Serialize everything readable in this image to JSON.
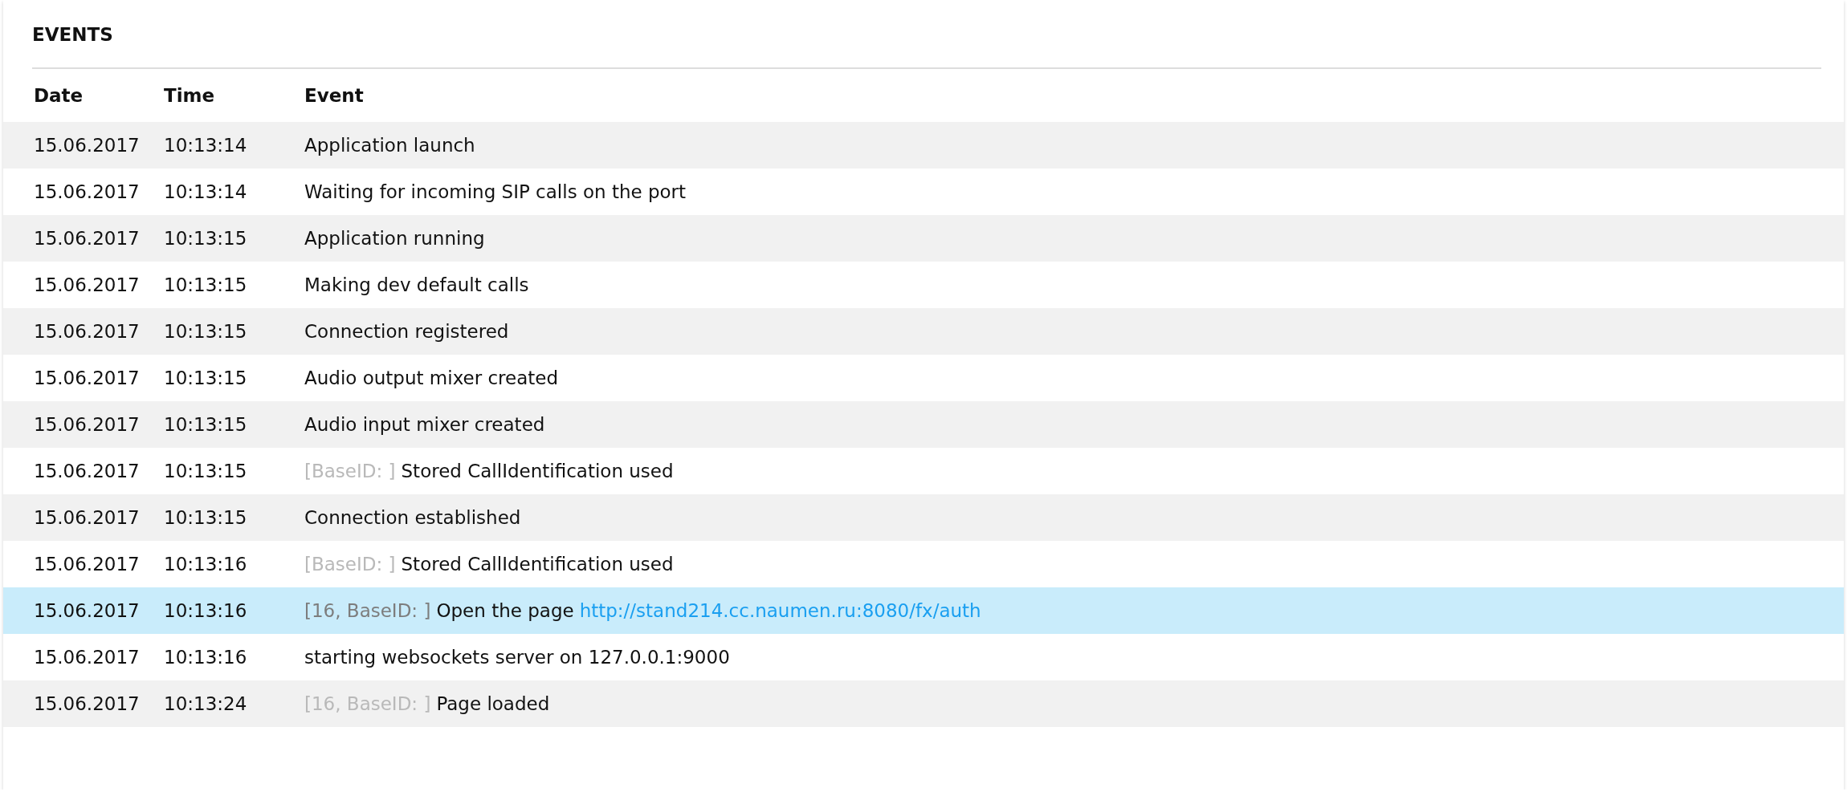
{
  "panel": {
    "title": "EVENTS"
  },
  "table": {
    "columns": [
      "Date",
      "Time",
      "Event"
    ],
    "rows": [
      {
        "date": "15.06.2017",
        "time": "10:13:14",
        "message": "Application launch",
        "selected": false
      },
      {
        "date": "15.06.2017",
        "time": "10:13:14",
        "message": "Waiting for incoming SIP calls on the port",
        "selected": false
      },
      {
        "date": "15.06.2017",
        "time": "10:13:15",
        "message": "Application running",
        "selected": false
      },
      {
        "date": "15.06.2017",
        "time": "10:13:15",
        "message": "Making dev default calls",
        "selected": false
      },
      {
        "date": "15.06.2017",
        "time": "10:13:15",
        "message": "Connection registered",
        "selected": false
      },
      {
        "date": "15.06.2017",
        "time": "10:13:15",
        "message": "Audio output mixer created",
        "selected": false
      },
      {
        "date": "15.06.2017",
        "time": "10:13:15",
        "message": "Audio input mixer created",
        "selected": false
      },
      {
        "date": "15.06.2017",
        "time": "10:13:15",
        "prefix": "[BaseID: ]",
        "message": "Stored CallIdentification used",
        "selected": false
      },
      {
        "date": "15.06.2017",
        "time": "10:13:15",
        "message": "Connection established",
        "selected": false
      },
      {
        "date": "15.06.2017",
        "time": "10:13:16",
        "prefix": "[BaseID: ]",
        "message": "Stored CallIdentification used",
        "selected": false
      },
      {
        "date": "15.06.2017",
        "time": "10:13:16",
        "prefix": "[16, BaseID: ]",
        "message": "Open the page",
        "link": "http://stand214.cc.naumen.ru:8080/fx/auth",
        "selected": true
      },
      {
        "date": "15.06.2017",
        "time": "10:13:16",
        "message": "starting websockets server on 127.0.0.1:9000",
        "selected": false
      },
      {
        "date": "15.06.2017",
        "time": "10:13:24",
        "prefix": "[16, BaseID: ]",
        "message": "Page loaded",
        "selected": false
      }
    ]
  }
}
